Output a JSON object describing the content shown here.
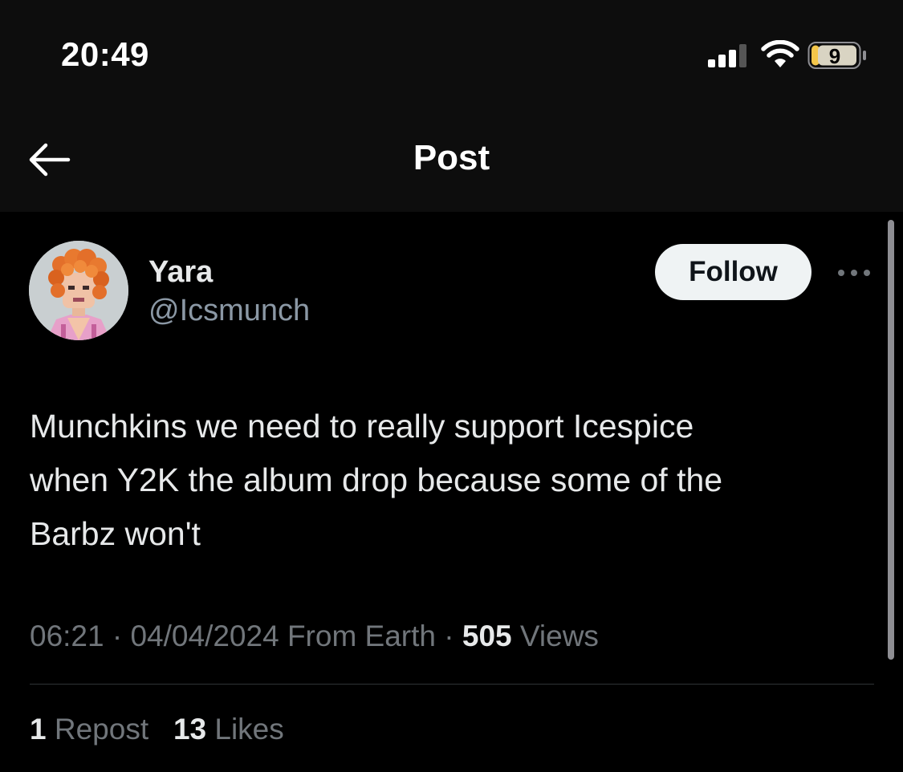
{
  "status_bar": {
    "time": "20:49",
    "battery_level": "9",
    "signal_icon": "cellular-signal-icon",
    "wifi_icon": "wifi-icon",
    "battery_icon": "battery-icon",
    "battery_color": "#f4c64a"
  },
  "nav": {
    "back_icon": "arrow-left-icon",
    "title": "Post"
  },
  "post": {
    "author": {
      "display_name": "Yara",
      "handle": "@Icsmunch",
      "avatar": "pixel-art-avatar-orange-curly-hair"
    },
    "follow_label": "Follow",
    "more_icon": "more-horizontal-icon",
    "text": "Munchkins we need to really support Icespice\nwhen Y2K the album drop because some of the\nBarbz won't",
    "meta": {
      "time": "06:21",
      "separator": "·",
      "date": "04/04/2024",
      "source": "From Earth",
      "views_count": "505",
      "views_label": "Views"
    },
    "stats": {
      "reposts_count": "1",
      "reposts_label": "Repost",
      "likes_count": "13",
      "likes_label": "Likes"
    }
  },
  "colors": {
    "background": "#000000",
    "header_background": "#0d0d0d",
    "primary_text": "#e7e9ea",
    "secondary_text": "#71767b",
    "handle_text": "#8b98a5",
    "follow_button_bg": "#eff3f4",
    "divider": "#2f3336"
  }
}
